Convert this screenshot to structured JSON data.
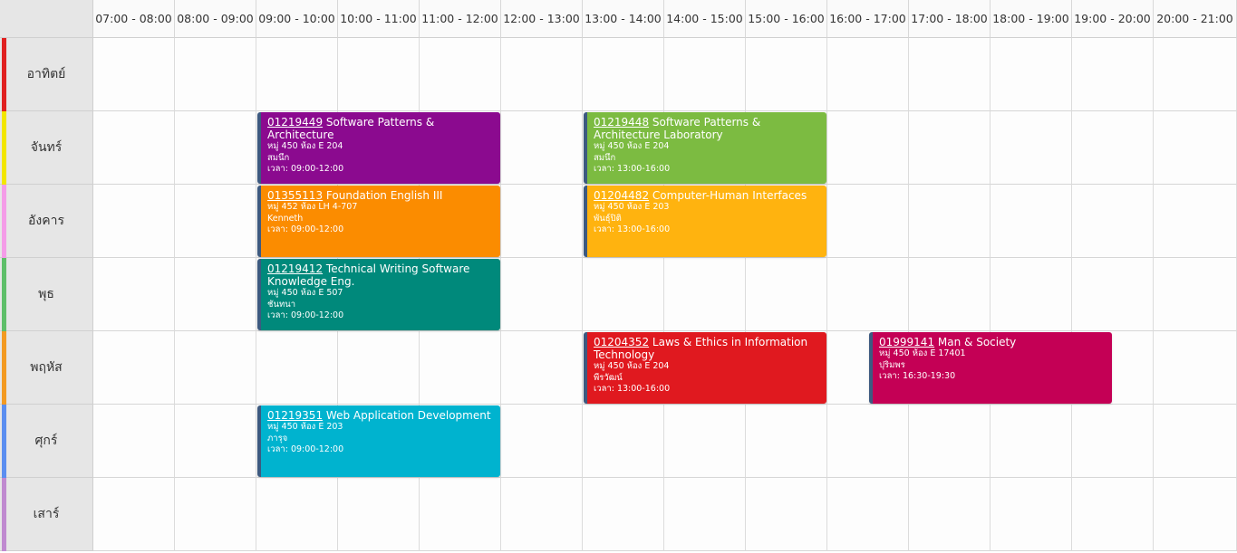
{
  "timetable": {
    "time_slots": [
      "07:00 - 08:00",
      "08:00 - 09:00",
      "09:00 - 10:00",
      "10:00 - 11:00",
      "11:00 - 12:00",
      "12:00 - 13:00",
      "13:00 - 14:00",
      "14:00 - 15:00",
      "15:00 - 16:00",
      "16:00 - 17:00",
      "17:00 - 18:00",
      "18:00 - 19:00",
      "19:00 - 20:00",
      "20:00 - 21:00"
    ],
    "days": [
      {
        "label": "อาทิตย์",
        "color": "#e02020"
      },
      {
        "label": "จันทร์",
        "color": "#f2e600"
      },
      {
        "label": "อังคาร",
        "color": "#f49ce8"
      },
      {
        "label": "พุธ",
        "color": "#5fbf6a"
      },
      {
        "label": "พฤหัส",
        "color": "#f39a22"
      },
      {
        "label": "ศุกร์",
        "color": "#5b8ef0"
      },
      {
        "label": "เสาร์",
        "color": "#c08ad0"
      }
    ],
    "courses": [
      {
        "day": 1,
        "start": 9,
        "end": 12,
        "code": "01219449",
        "name": "Software Patterns & Architecture",
        "section": "หมู่ 450 ห้อง E 204",
        "instructor": "สมนึก",
        "time": "เวลา: 09:00-12:00",
        "color": "#8b0a8f"
      },
      {
        "day": 1,
        "start": 13,
        "end": 16,
        "code": "01219448",
        "name": "Software Patterns & Architecture Laboratory",
        "section": "หมู่ 450 ห้อง E 204",
        "instructor": "สมนึก",
        "time": "เวลา: 13:00-16:00",
        "color": "#7cbb41"
      },
      {
        "day": 2,
        "start": 9,
        "end": 12,
        "code": "01355113",
        "name": "Foundation English III",
        "section": "หมู่ 452 ห้อง LH 4-707",
        "instructor": "Kenneth",
        "time": "เวลา: 09:00-12:00",
        "color": "#fb8c00"
      },
      {
        "day": 2,
        "start": 13,
        "end": 16,
        "code": "01204482",
        "name": "Computer-Human Interfaces",
        "section": "หมู่ 450 ห้อง E 203",
        "instructor": "พันธุ์ปิติ",
        "time": "เวลา: 13:00-16:00",
        "color": "#ffb30f"
      },
      {
        "day": 3,
        "start": 9,
        "end": 12,
        "code": "01219412",
        "name": "Technical Writing Software Knowledge Eng.",
        "section": "หมู่ 450 ห้อง E 507",
        "instructor": "ชันทนา",
        "time": "เวลา: 09:00-12:00",
        "color": "#00897b"
      },
      {
        "day": 4,
        "start": 13,
        "end": 16,
        "code": "01204352",
        "name": "Laws & Ethics in Information Technology",
        "section": "หมู่ 450 ห้อง E 204",
        "instructor": "พีรวัฒน์",
        "time": "เวลา: 13:00-16:00",
        "color": "#e0191f"
      },
      {
        "day": 4,
        "start": 16.5,
        "end": 19.5,
        "code": "01999141",
        "name": "Man & Society",
        "section": "หมู่ 450 ห้อง E 17401",
        "instructor": "ปุริมพร",
        "time": "เวลา: 16:30-19:30",
        "color": "#c40055"
      },
      {
        "day": 5,
        "start": 9,
        "end": 12,
        "code": "01219351",
        "name": "Web Application Development",
        "section": "หมู่ 450 ห้อง E 203",
        "instructor": "ภารุจ",
        "time": "เวลา: 09:00-12:00",
        "color": "#00b3cf"
      }
    ]
  }
}
